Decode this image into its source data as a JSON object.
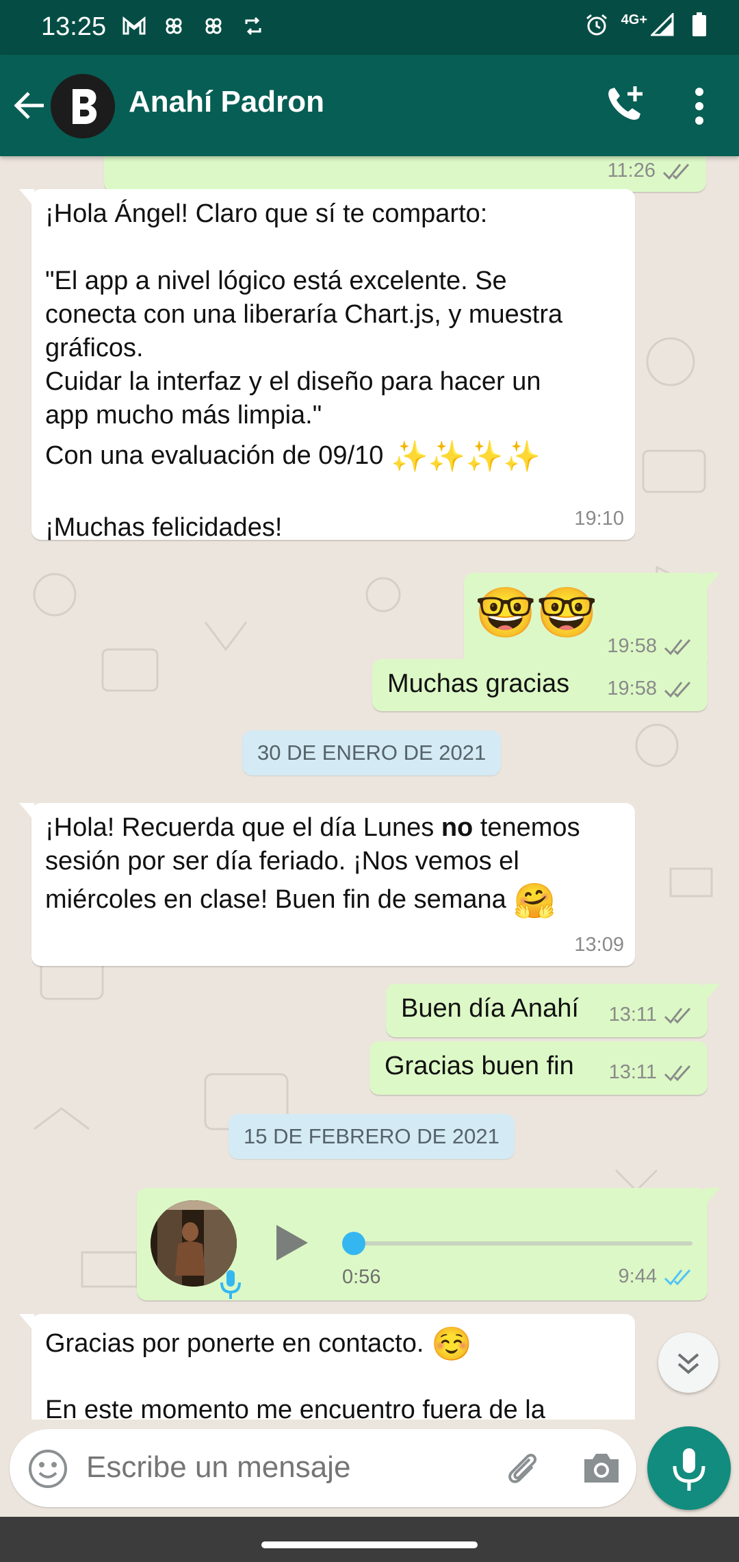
{
  "status_bar": {
    "time": "13:25",
    "left_icons": [
      "gmail-icon",
      "pinwheel-icon",
      "pinwheel-icon",
      "sync-icon"
    ],
    "network": "4G+",
    "right_icons": [
      "alarm-icon",
      "signal-icon",
      "battery-icon"
    ]
  },
  "header": {
    "contact_name": "Anahí Padron",
    "avatar_icon": "b-logo-icon",
    "actions": [
      "add-call-icon",
      "more-vert-icon"
    ]
  },
  "messages": {
    "m0": {
      "time": "11:26"
    },
    "m1": {
      "line1": "¡Hola Ángel! Claro que sí te comparto:",
      "line2": "\"El app a nivel lógico está excelente. Se",
      "line3": "conecta con una liberaría Chart.js,  y muestra",
      "line4": "gráficos.",
      "line5": "Cuidar la interfaz y el diseño para hacer un",
      "line6": "app mucho más limpia.\"",
      "line7": "Con una evaluación de 09/10",
      "line7_emoji": "✨✨✨✨",
      "line8": "¡Muchas felicidades!",
      "time": "19:10"
    },
    "m2": {
      "emoji": "🤓🤓",
      "time": "19:58"
    },
    "m3": {
      "text": "Muchas gracias",
      "time": "19:58"
    },
    "date1": "30 DE ENERO DE 2021",
    "m4": {
      "line1a": "¡Hola! Recuerda que el día Lunes ",
      "line1b": "no",
      "line1c": " tenemos",
      "line2": "sesión por ser día feriado. ¡Nos vemos el",
      "line3": "miércoles en clase! Buen fin de semana",
      "line3_emoji": "🤗",
      "time": "13:09"
    },
    "m5": {
      "text": "Buen día Anahí",
      "time": "13:11"
    },
    "m6": {
      "text": "Gracias buen fin",
      "time": "13:11"
    },
    "date2": "15 DE FEBRERO DE 2021",
    "voice": {
      "duration": "0:56",
      "time": "9:44",
      "progress": 0
    },
    "m7": {
      "line1": "Gracias por ponerte en contacto.",
      "line1_emoji": "☺️",
      "line2": "En este momento me encuentro fuera de la"
    }
  },
  "composer": {
    "placeholder": "Escribe un mensaje"
  },
  "colors": {
    "status_bar": "#054d44",
    "app_bar": "#075e54",
    "outgoing_bubble": "#dcf8c6",
    "incoming_bubble": "#ffffff",
    "chat_bg": "#ece5dd",
    "read_ticks": "#4fc3f7",
    "mic_button": "#128c7e"
  }
}
